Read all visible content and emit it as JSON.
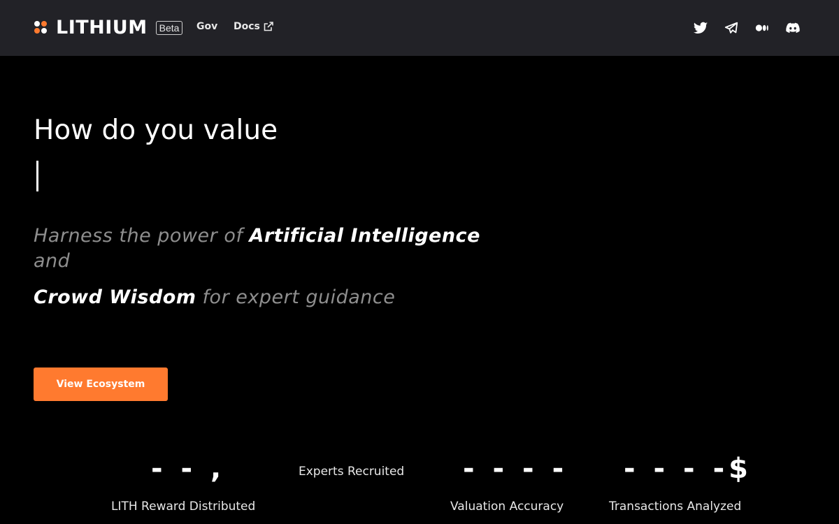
{
  "header": {
    "brand": "LITHIUM",
    "badge": "Beta",
    "nav": {
      "gov": "Gov",
      "docs": "Docs"
    },
    "social": [
      "twitter-icon",
      "telegram-icon",
      "medium-icon",
      "discord-icon"
    ],
    "bg_color": "#222227"
  },
  "hero": {
    "title": "How do you value",
    "subtitle": {
      "part1_light": "Harness the power of ",
      "part1_strong": "Artificial Intelligence",
      "part2_light": "and",
      "part3_strong": "Crowd Wisdom",
      "part3_light": " for expert guidance"
    },
    "cta_label": "View Ecosystem",
    "accent_color": "#ff7a2f"
  },
  "stats": [
    {
      "value": "- - ,",
      "label": "LITH Reward Distributed"
    },
    {
      "value": "",
      "label": "Experts Recruited"
    },
    {
      "value": "- - - -",
      "label": "Valuation Accuracy"
    },
    {
      "value": "- - - -$",
      "label": "Transactions Analyzed"
    }
  ]
}
